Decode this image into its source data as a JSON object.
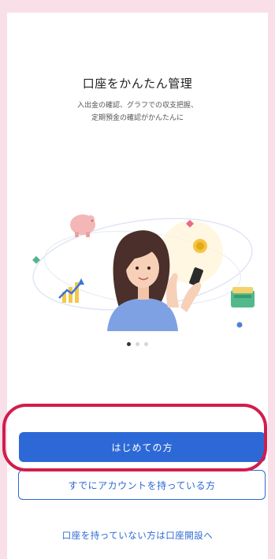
{
  "intro": {
    "title": "口座をかんたん管理",
    "subtitle_line1": "入出金の確認、グラフでの収支把握、",
    "subtitle_line2": "定期預金の確認がかんたんに"
  },
  "carousel": {
    "page_count": 3,
    "active_index": 0
  },
  "actions": {
    "primary_label": "はじめての方",
    "secondary_label": "すでにアカウントを持っている方",
    "open_account_link": "口座を持っていない方は口座開設へ"
  },
  "colors": {
    "brand_blue": "#2d69d6",
    "highlight_red": "#d11d4d",
    "background_pink": "#f9dfe8"
  },
  "icons": [
    "piggy-bank-icon",
    "coin-icon",
    "chart-up-icon",
    "wallet-icon",
    "sparkle-icon"
  ]
}
